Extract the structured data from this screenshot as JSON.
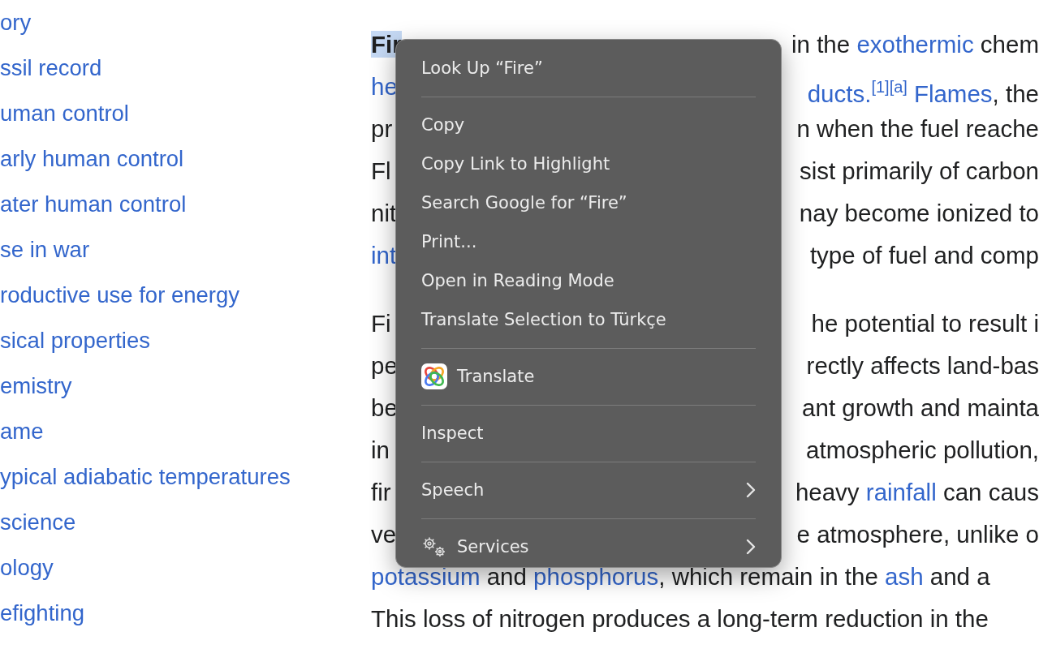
{
  "sidebar": {
    "items": [
      {
        "label": "ory"
      },
      {
        "label": "ssil record"
      },
      {
        "label": "uman control"
      },
      {
        "label": "arly human control"
      },
      {
        "label": "ater human control"
      },
      {
        "label": "se in war"
      },
      {
        "label": "roductive use for energy"
      },
      {
        "label": "sical properties"
      },
      {
        "label": "emistry"
      },
      {
        "label": "ame"
      },
      {
        "label": "ypical adiabatic temperatures"
      },
      {
        "label": "science"
      },
      {
        "label": "ology"
      },
      {
        "label": "efighting"
      }
    ]
  },
  "article": {
    "paragraphs": [
      {
        "lines": [
          {
            "left": [
              {
                "text": "Fir",
                "kind": "bold",
                "highlighted": true
              }
            ],
            "right": [
              {
                "text": "in the ",
                "kind": "plain"
              },
              {
                "text": "exothermic",
                "kind": "link"
              },
              {
                "text": " chem",
                "kind": "plain"
              }
            ]
          },
          {
            "left": [
              {
                "text": "he",
                "kind": "link"
              }
            ],
            "right": [
              {
                "text": "ducts.",
                "kind": "link"
              },
              {
                "text": "[1][a]",
                "kind": "sup"
              },
              {
                "text": "Flames",
                "kind": "link"
              },
              {
                "text": ", the",
                "kind": "plain"
              }
            ]
          },
          {
            "left": [
              {
                "text": "pr",
                "kind": "plain"
              }
            ],
            "right": [
              {
                "text": "n when the fuel reache",
                "kind": "plain"
              }
            ]
          },
          {
            "left": [
              {
                "text": "Fl",
                "kind": "plain"
              }
            ],
            "right": [
              {
                "text": "sist primarily of carbon",
                "kind": "plain"
              }
            ]
          },
          {
            "left": [
              {
                "text": "nit",
                "kind": "plain"
              }
            ],
            "right": [
              {
                "text": "nay become ionized to",
                "kind": "plain"
              }
            ]
          },
          {
            "left": [
              {
                "text": "int",
                "kind": "link"
              }
            ],
            "right": [
              {
                "text": "type of fuel and comp",
                "kind": "plain"
              }
            ]
          }
        ]
      },
      {
        "lines": [
          {
            "left": [
              {
                "text": "Fi",
                "kind": "plain"
              }
            ],
            "right": [
              {
                "text": "he potential to result i",
                "kind": "plain"
              }
            ]
          },
          {
            "left": [
              {
                "text": "pe",
                "kind": "plain"
              }
            ],
            "right": [
              {
                "text": "rectly affects land-bas",
                "kind": "plain"
              }
            ]
          },
          {
            "left": [
              {
                "text": "be",
                "kind": "plain"
              }
            ],
            "right": [
              {
                "text": "ant growth and mainta",
                "kind": "plain"
              }
            ]
          },
          {
            "left": [
              {
                "text": "in",
                "kind": "plain"
              }
            ],
            "right": [
              {
                "text": "atmospheric pollution,",
                "kind": "plain"
              }
            ]
          },
          {
            "left": [
              {
                "text": "fir",
                "kind": "plain"
              }
            ],
            "right": [
              {
                "text": "heavy ",
                "kind": "plain"
              },
              {
                "text": "rainfall",
                "kind": "link"
              },
              {
                "text": " can caus",
                "kind": "plain"
              }
            ]
          },
          {
            "left": [
              {
                "text": "ve",
                "kind": "plain"
              }
            ],
            "right": [
              {
                "text": "e atmosphere, unlike o",
                "kind": "plain"
              }
            ]
          },
          {
            "left": [
              {
                "text": "potassium",
                "kind": "link"
              },
              {
                "text": " and ",
                "kind": "plain"
              },
              {
                "text": "phosphorus",
                "kind": "link"
              },
              {
                "text": ", which remain in the ",
                "kind": "plain"
              },
              {
                "text": "ash",
                "kind": "link"
              },
              {
                "text": " and a",
                "kind": "plain"
              }
            ]
          },
          {
            "left": [
              {
                "text": "This loss of nitrogen produces a long-term reduction in the",
                "kind": "plain"
              }
            ]
          }
        ]
      }
    ]
  },
  "context_menu": {
    "entries": [
      {
        "kind": "item",
        "label": "Look Up “Fire”",
        "submenu": false
      },
      {
        "kind": "separator"
      },
      {
        "kind": "item",
        "label": "Copy",
        "submenu": false
      },
      {
        "kind": "item",
        "label": "Copy Link to Highlight",
        "submenu": false
      },
      {
        "kind": "item",
        "label": "Search Google for “Fire”",
        "submenu": false
      },
      {
        "kind": "item",
        "label": "Print...",
        "submenu": false
      },
      {
        "kind": "item",
        "label": "Open in Reading Mode",
        "submenu": false
      },
      {
        "kind": "item",
        "label": "Translate Selection to Türkçe",
        "submenu": false
      },
      {
        "kind": "separator"
      },
      {
        "kind": "app",
        "label": "Translate",
        "submenu": false
      },
      {
        "kind": "separator"
      },
      {
        "kind": "item",
        "label": "Inspect",
        "submenu": false
      },
      {
        "kind": "separator"
      },
      {
        "kind": "item",
        "label": "Speech",
        "submenu": true
      },
      {
        "kind": "separator"
      },
      {
        "kind": "services",
        "label": "Services",
        "submenu": true
      }
    ]
  }
}
